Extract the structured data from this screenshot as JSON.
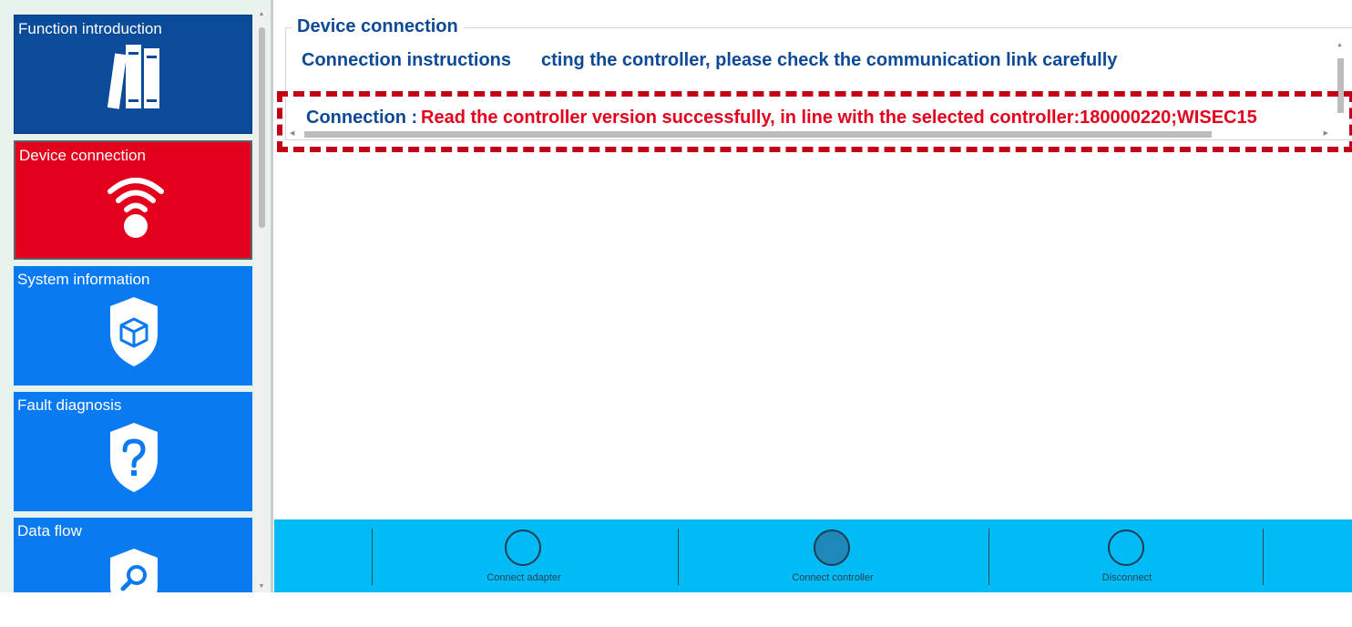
{
  "sidebar": {
    "items": [
      {
        "label": "Function introduction",
        "icon": "books-icon",
        "color": "#0a4b9a"
      },
      {
        "label": "Device connection",
        "icon": "wifi-icon",
        "color": "#e4001c",
        "selected": true
      },
      {
        "label": "System information",
        "icon": "shield-cube-icon",
        "color": "#0a7af2"
      },
      {
        "label": "Fault diagnosis",
        "icon": "shield-question-icon",
        "color": "#0a7af2"
      },
      {
        "label": "Data flow",
        "icon": "shield-search-icon",
        "color": "#0a7af2"
      }
    ]
  },
  "panel": {
    "title": "Device connection",
    "instructions_label": "Connection instructions",
    "instructions_message": "cting the controller, please check the communication link carefully",
    "connection_label": "Connection :",
    "connection_message": "Read the controller version successfully, in line with the selected controller:180000220;WISEC15"
  },
  "toolbar": {
    "buttons": [
      {
        "label": "Connect adapter"
      },
      {
        "label": "Connect controller"
      },
      {
        "label": "Disconnect"
      }
    ]
  },
  "colors": {
    "selected_tile": "#e4001c",
    "tile_blue": "#0a7af2",
    "tile_navy": "#0a4b9a",
    "heading_text": "#0d4a96",
    "status_text": "#e4001c",
    "toolbar": "#00bbf5"
  }
}
